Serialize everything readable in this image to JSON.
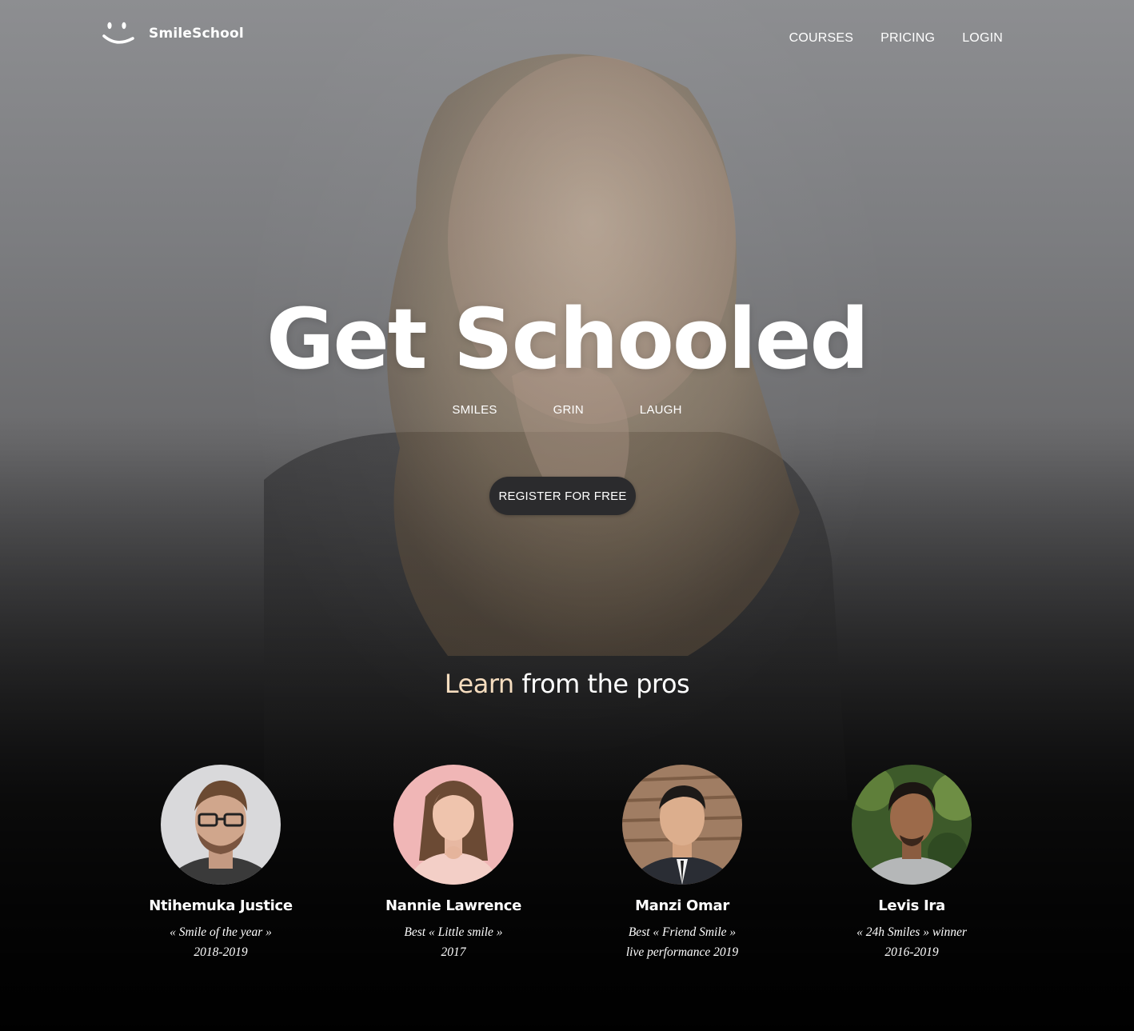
{
  "brand": {
    "name": "SmileSchool"
  },
  "nav": {
    "items": [
      {
        "label": "COURSES"
      },
      {
        "label": "PRICING"
      },
      {
        "label": "LOGIN"
      }
    ]
  },
  "hero": {
    "title": "Get Schooled",
    "tags": [
      "SMILES",
      "GRIN",
      "LAUGH"
    ],
    "cta_label": "REGISTER FOR FREE"
  },
  "learn": {
    "title_accent": "Learn",
    "title_rest": "from the pros",
    "accent_color": "#f6ddbf"
  },
  "pros": [
    {
      "name": "Ntihemuka Justice",
      "award_line1": "« Smile of the year »",
      "award_line2": "2018-2019"
    },
    {
      "name": "Nannie Lawrence",
      "award_line1": "Best « Little smile »",
      "award_line2": "2017"
    },
    {
      "name": "Manzi Omar",
      "award_line1": "Best « Friend Smile »",
      "award_line2": "live performance 2019"
    },
    {
      "name": "Levis Ira",
      "award_line1": "« 24h Smiles » winner",
      "award_line2": "2016-2019"
    }
  ],
  "colors": {
    "button_bg": "#2b2b2d",
    "text": "#ffffff"
  }
}
